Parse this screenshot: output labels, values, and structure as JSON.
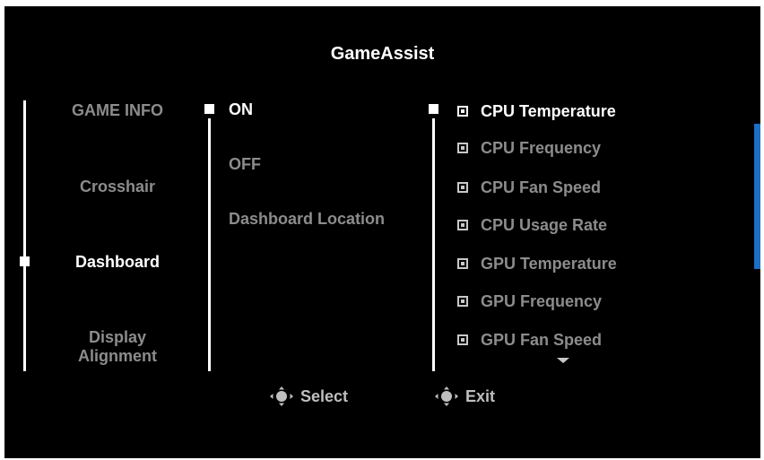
{
  "title": "GameAssist",
  "menu": {
    "items": [
      {
        "label": "GAME INFO"
      },
      {
        "label": "Crosshair"
      },
      {
        "label": "Dashboard"
      },
      {
        "label": "Display Alignment"
      }
    ],
    "selected": "Dashboard"
  },
  "submenu": {
    "items": [
      {
        "label": "ON"
      },
      {
        "label": "OFF"
      },
      {
        "label": "Dashboard Location"
      }
    ],
    "selected": "ON"
  },
  "options": {
    "items": [
      {
        "label": "CPU Temperature",
        "checked": true
      },
      {
        "label": "CPU Frequency",
        "checked": true
      },
      {
        "label": "CPU Fan Speed",
        "checked": true
      },
      {
        "label": "CPU Usage Rate",
        "checked": true
      },
      {
        "label": "GPU Temperature",
        "checked": true
      },
      {
        "label": "GPU Frequency",
        "checked": true
      },
      {
        "label": "GPU Fan Speed",
        "checked": true
      }
    ],
    "selected": "CPU Temperature"
  },
  "footer": {
    "select_label": "Select",
    "exit_label": "Exit"
  },
  "colors": {
    "background": "#000000",
    "active_text": "#ffffff",
    "inactive_text": "#8c8c8c",
    "scrollbar": "#1b6fc4"
  }
}
